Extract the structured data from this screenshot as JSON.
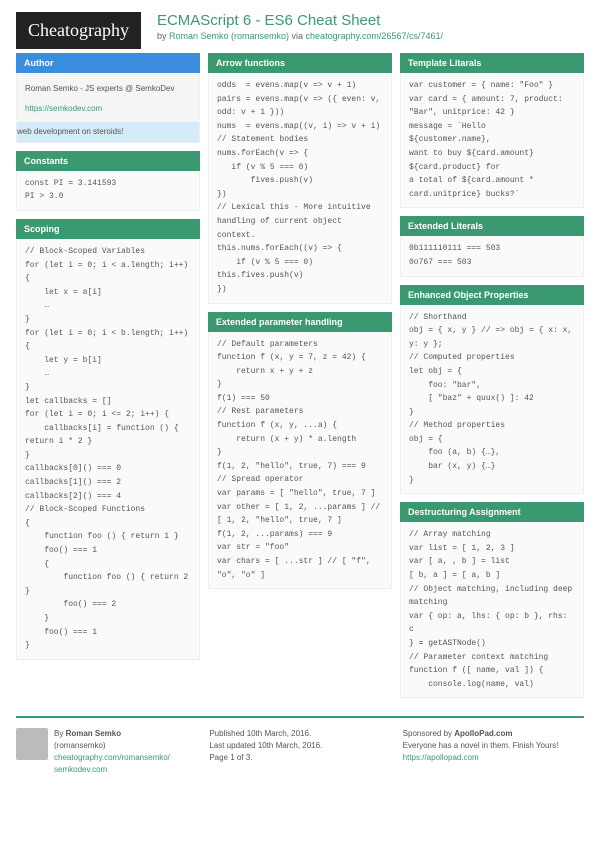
{
  "logo": "Cheatography",
  "title": "ECMAScript 6 - ES6 Cheat Sheet",
  "byline_prefix": "by ",
  "author_name": "Roman Semko (romansemko)",
  "byline_via": " via ",
  "byline_link": "cheatography.com/26567/cs/7461/",
  "col1": {
    "author": {
      "head": "Author",
      "line1": "Roman Semko - JS experts @ SemkoDev",
      "link": "https://semkodev.com",
      "tag": "web development on steroids!"
    },
    "constants": {
      "head": "Constants",
      "body": "const PI = 3.141593\nPI > 3.0"
    },
    "scoping": {
      "head": "Scoping",
      "body": "// Block-Scoped Variables\nfor (let i = 0; i < a.length; i++)\n{\n    let x = a[i]\n    …\n}\nfor (let i = 0; i < b.length; i++)\n{\n    let y = b[i]\n    …\n}\nlet callbacks = []\nfor (let i = 0; i <= 2; i++) {\n    callbacks[i] = function () {\nreturn i * 2 }\n}\ncallbacks[0]() === 0\ncallbacks[1]() === 2\ncallbacks[2]() === 4\n// Block-Scoped Functions\n{\n    function foo () { return 1 }\n    foo() === 1\n    {\n        function foo () { return 2\n}\n        foo() === 2\n    }\n    foo() === 1\n}"
    }
  },
  "col2": {
    "arrow": {
      "head": "Arrow functions",
      "body": "odds  = evens.map(v => v + 1)\npairs = evens.map(v => ({ even: v,\nodd: v + 1 }))\nnums  = evens.map((v, i) => v + i)\n// Statement bodies\nnums.forEach(v => {\n   if (v % 5 === 0)\n       fives.push(v)\n})\n// Lexical this - More intuitive\nhandling of current object context.\nthis.nums.forEach((v) => {\n    if (v % 5 === 0)\nthis.fives.push(v)\n})"
    },
    "ext": {
      "head": "Extended parameter handling",
      "body": "// Default parameters\nfunction f (x, y = 7, z = 42) {\n    return x + y + z\n}\nf(1) === 50\n// Rest parameters\nfunction f (x, y, ...a) {\n    return (x + y) * a.length\n}\nf(1, 2, \"hello\", true, 7) === 9\n// Spread operator\nvar params = [ \"hello\", true, 7 ]\nvar other = [ 1, 2, ...params ] //\n[ 1, 2, \"hello\", true, 7 ]\nf(1, 2, ...params) === 9\nvar str = \"foo\"\nvar chars = [ ...str ] // [ \"f\",\n\"o\", \"o\" ]"
    }
  },
  "col3": {
    "template": {
      "head": "Template Litarals",
      "body": "var customer = { name: \"Foo\" }\nvar card = { amount: 7, product:\n\"Bar\", unitprice: 42 }\nmessage = `Hello\n${customer.name},\nwant to buy ${card.amount}\n${card.product} for\na total of ${card.amount *\ncard.unitprice} bucks?`"
    },
    "extlit": {
      "head": "Extended Literals",
      "body": "0b111110111 === 503\n0o767 === 503"
    },
    "enhobj": {
      "head": "Enhanced Object Properties",
      "body": "// Shorthand\nobj = { x, y } // => obj = { x: x,\ny: y };\n// Computed properties\nlet obj = {\n    foo: \"bar\",\n    [ \"baz\" + quux() ]: 42\n}\n// Method properties\nobj = {\n    foo (a, b) {…},\n    bar (x, y) {…}\n}"
    },
    "destruct": {
      "head": "Destructuring Assignment",
      "body": "// Array matching\nvar list = [ 1, 2, 3 ]\nvar [ a, , b ] = list\n[ b, a ] = [ a, b ]\n// Object matching, including deep\nmatching\nvar { op: a, lhs: { op: b }, rhs: c\n} = getASTNode()\n// Parameter context matching\nfunction f ([ name, val ]) {\n    console.log(name, val)"
    }
  },
  "footer": {
    "by": "By ",
    "name": "Roman Semko",
    "handle": "(romansemko)",
    "link1": "cheatography.com/romansemko/",
    "link2": "semkodev.com",
    "pub": "Published 10th March, 2016.",
    "upd": "Last updated 10th March, 2016.",
    "page": "Page 1 of 3.",
    "spons": "Sponsored by ",
    "sponsname": "ApolloPad.com",
    "sponstag": "Everyone has a novel in them. Finish Yours!",
    "sponslink": "https://apollopad.com"
  }
}
